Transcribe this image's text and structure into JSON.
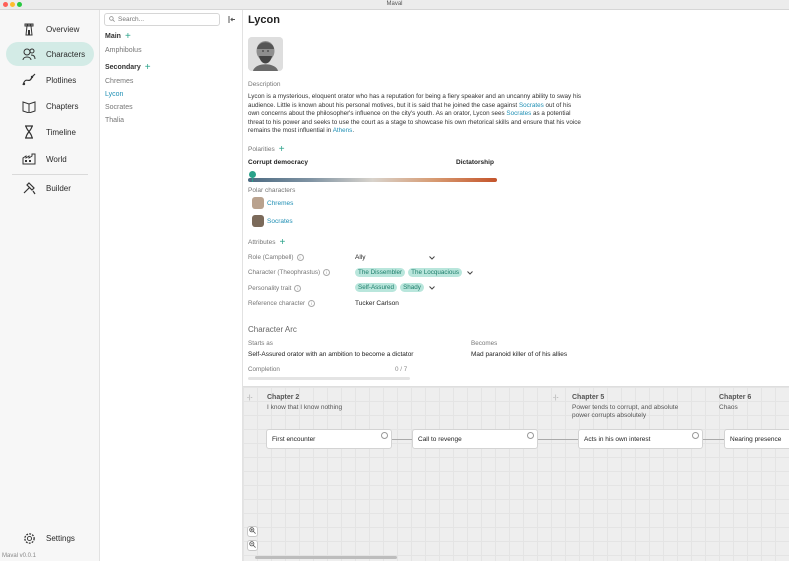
{
  "app": {
    "title": "Maval",
    "version": "Maval v0.0.1"
  },
  "nav": {
    "items": [
      {
        "label": "Overview",
        "icon": "tower-icon"
      },
      {
        "label": "Characters",
        "icon": "characters-icon",
        "active": true
      },
      {
        "label": "Plotlines",
        "icon": "plotlines-icon"
      },
      {
        "label": "Chapters",
        "icon": "chapters-icon"
      },
      {
        "label": "Timeline",
        "icon": "hourglass-icon"
      },
      {
        "label": "World",
        "icon": "world-icon"
      },
      {
        "label": "Builder",
        "icon": "builder-icon"
      }
    ],
    "settings": "Settings"
  },
  "list": {
    "search_placeholder": "Search...",
    "groups": {
      "main": {
        "title": "Main",
        "items": [
          "Amphibolus"
        ]
      },
      "secondary": {
        "title": "Secondary",
        "items": [
          "Chremes",
          "Lycon",
          "Socrates",
          "Thalia"
        ]
      }
    },
    "selected": "Lycon"
  },
  "character": {
    "name": "Lycon",
    "description_label": "Description",
    "description": {
      "p1": "Lycon is a mysterious, eloquent orator who has a reputation for being a fiery speaker and an uncanny ability to sway his audience. Little is known about his personal motives, but it is said that he joined the case against ",
      "link1": "Socrates",
      "p2": " out of his own concerns about the philosopher's influence on the city's youth. As an orator, Lycon sees ",
      "link2": "Socrates",
      "p3": " as a potential threat to his power and seeks to use the court as a stage to showcase his own rhetorical skills and ensure that his voice remains the most influential in ",
      "link3": "Athens",
      "p4": "."
    },
    "polarities": {
      "label": "Polarities",
      "left": "Corrupt democracy",
      "right": "Dictatorship",
      "position": 0.02,
      "polar_label": "Polar characters",
      "polar_characters": [
        "Chremes",
        "Socrates"
      ]
    },
    "attributes": {
      "label": "Attributes",
      "role": {
        "label": "Role (Campbell)",
        "value": "Ally"
      },
      "character": {
        "label": "Character (Theophrastus)",
        "chips": [
          "The Dissembler",
          "The Locquacious"
        ]
      },
      "personality": {
        "label": "Personality trait",
        "chips": [
          "Self-Assured",
          "Shady"
        ]
      },
      "reference": {
        "label": "Reference character",
        "value": "Tucker Carlson"
      }
    },
    "arc": {
      "title": "Character Arc",
      "starts_label": "Starts as",
      "starts_value": "Self-Assured orator with an ambition to become a dictator",
      "becomes_label": "Becomes",
      "becomes_value": "Mad paranoid killer of of his allies",
      "completion_label": "Completion",
      "completion_count": "0 / 7",
      "completion": 0
    }
  },
  "timeline": {
    "chapters": [
      {
        "title": "Chapter 2",
        "subtitle": "I know that I know nothing"
      },
      {
        "title": "Chapter 5",
        "subtitle": "Power tends to corrupt, and absolute power corrupts absolutely"
      },
      {
        "title": "Chapter 6",
        "subtitle": "Chaos"
      }
    ],
    "cards": [
      "First encounter",
      "Call to revenge",
      "Acts in his own interest",
      "Nearing presence"
    ]
  },
  "colors": {
    "accent": "#2aa28a",
    "link": "#1f8fb4",
    "active_nav": "#d3ebe6",
    "chip_bg": "#b9e6dc"
  }
}
